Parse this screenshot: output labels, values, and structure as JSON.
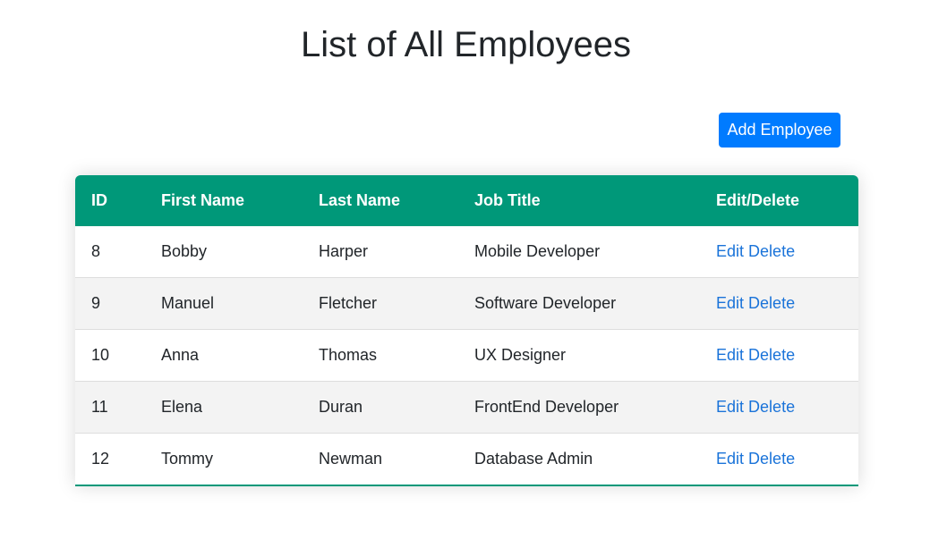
{
  "page": {
    "title": "List of All Employees",
    "add_button_label": "Add Employee"
  },
  "table": {
    "headers": [
      "ID",
      "First Name",
      "Last Name",
      "Job Title",
      "Edit/Delete"
    ],
    "rows": [
      {
        "id": "8",
        "first_name": "Bobby",
        "last_name": "Harper",
        "job_title": "Mobile Developer"
      },
      {
        "id": "9",
        "first_name": "Manuel",
        "last_name": "Fletcher",
        "job_title": "Software Developer"
      },
      {
        "id": "10",
        "first_name": "Anna",
        "last_name": "Thomas",
        "job_title": "UX Designer"
      },
      {
        "id": "11",
        "first_name": "Elena",
        "last_name": "Duran",
        "job_title": "FrontEnd Developer"
      },
      {
        "id": "12",
        "first_name": "Tommy",
        "last_name": "Newman",
        "job_title": "Database Admin"
      }
    ],
    "edit_label": "Edit",
    "delete_label": "Delete"
  },
  "colors": {
    "header_bg": "#009879",
    "button_bg": "#007bff",
    "link": "#1a73d9",
    "alt_row_bg": "#f3f3f3"
  }
}
